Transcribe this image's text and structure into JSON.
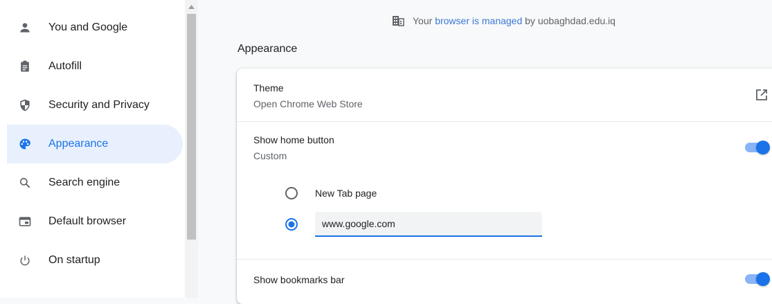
{
  "sidebar": {
    "items": [
      {
        "label": "You and Google",
        "icon": "person-icon"
      },
      {
        "label": "Autofill",
        "icon": "clipboard-icon"
      },
      {
        "label": "Security and Privacy",
        "icon": "shield-icon"
      },
      {
        "label": "Appearance",
        "icon": "palette-icon",
        "active": true
      },
      {
        "label": "Search engine",
        "icon": "search-icon"
      },
      {
        "label": "Default browser",
        "icon": "browser-window-icon"
      },
      {
        "label": "On startup",
        "icon": "power-icon"
      }
    ]
  },
  "managed": {
    "prefix": "Your",
    "link": "browser is managed",
    "suffix": "by uobaghdad.edu.iq"
  },
  "section": {
    "title": "Appearance"
  },
  "theme": {
    "title": "Theme",
    "subtitle": "Open Chrome Web Store"
  },
  "home_button": {
    "title": "Show home button",
    "subtitle": "Custom",
    "enabled": true,
    "options": [
      {
        "label": "New Tab page",
        "selected": false
      },
      {
        "label": "",
        "selected": true
      }
    ],
    "custom_url": "www.google.com"
  },
  "bookmarks_bar": {
    "title": "Show bookmarks bar",
    "enabled": true
  },
  "colors": {
    "accent": "#1a73e8",
    "active_bg": "#e8f0fe",
    "toggle_track": "#8ab4f8"
  }
}
